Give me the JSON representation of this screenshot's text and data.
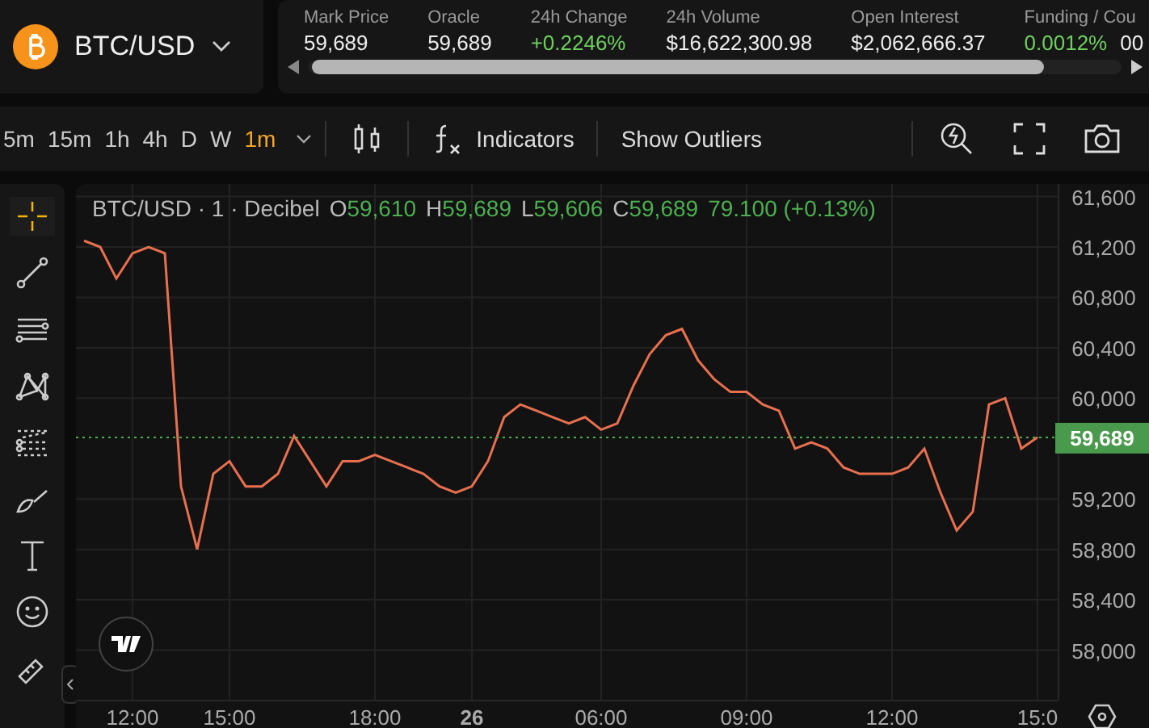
{
  "market": {
    "symbol": "BTC/USD"
  },
  "stats": [
    {
      "label": "Mark Price",
      "value": "59,689",
      "positive": false
    },
    {
      "label": "Oracle",
      "value": "59,689",
      "positive": false
    },
    {
      "label": "24h Change",
      "value": "+0.2246%",
      "positive": true
    },
    {
      "label": "24h Volume",
      "value": "$16,622,300.98",
      "positive": false
    },
    {
      "label": "Open Interest",
      "value": "$2,062,666.37",
      "positive": false
    },
    {
      "label": "Funding / Cou",
      "value": "0.0012%",
      "positive": true,
      "suffix": "00"
    }
  ],
  "toolbar": {
    "timeframes": [
      {
        "label": "5m",
        "selected": false
      },
      {
        "label": "15m",
        "selected": false
      },
      {
        "label": "1h",
        "selected": false
      },
      {
        "label": "4h",
        "selected": false
      },
      {
        "label": "D",
        "selected": false
      },
      {
        "label": "W",
        "selected": false
      },
      {
        "label": "1m",
        "selected": true
      }
    ],
    "indicators": "Indicators",
    "outliers": "Show Outliers"
  },
  "tools": [
    {
      "kind": "crosshair",
      "selected": true
    },
    {
      "kind": "trendline",
      "selected": false
    },
    {
      "kind": "lines",
      "selected": false
    },
    {
      "kind": "pattern",
      "selected": false
    },
    {
      "kind": "fib",
      "selected": false
    },
    {
      "kind": "brush",
      "selected": false
    },
    {
      "kind": "text",
      "selected": false
    },
    {
      "kind": "emoji",
      "selected": false
    },
    {
      "kind": "ruler",
      "selected": false
    }
  ],
  "legend": {
    "title": "BTC/USD · 1 · Decibel",
    "ohlc": [
      {
        "label": "O",
        "value": "59,610"
      },
      {
        "label": "H",
        "value": "59,689"
      },
      {
        "label": "L",
        "value": "59,606"
      },
      {
        "label": "C",
        "value": "59,689"
      }
    ],
    "change": "79.100 (+0.13%)"
  },
  "chart": {
    "chart_data": {
      "type": "line",
      "grid": true,
      "ylim": [
        57600,
        61700
      ],
      "categories": [
        null,
        null,
        null,
        "12:00",
        null,
        null,
        null,
        null,
        null,
        "15:00",
        null,
        null,
        null,
        null,
        null,
        null,
        null,
        null,
        "18:00",
        null,
        null,
        null,
        null,
        null,
        "26",
        null,
        null,
        null,
        null,
        null,
        null,
        null,
        "06:00",
        null,
        null,
        null,
        null,
        null,
        null,
        null,
        null,
        "09:00",
        null,
        null,
        null,
        null,
        null,
        null,
        null,
        null,
        "12:00",
        null,
        null,
        null,
        null,
        null,
        null,
        null,
        null,
        "15:0"
      ],
      "series": [
        {
          "color": "#e8704f",
          "values": [
            61250,
            61200,
            60950,
            61150,
            61200,
            61150,
            59300,
            58800,
            59400,
            59500,
            59300,
            59300,
            59400,
            59700,
            59500,
            59300,
            59500,
            59500,
            59550,
            59500,
            59450,
            59400,
            59300,
            59250,
            59300,
            59500,
            59850,
            59950,
            59900,
            59850,
            59800,
            59850,
            59750,
            59800,
            60100,
            60350,
            60500,
            60550,
            60300,
            60150,
            60050,
            60050,
            59950,
            59900,
            59600,
            59650,
            59600,
            59450,
            59400,
            59400,
            59400,
            59450,
            59600,
            59250,
            58950,
            59100,
            59950,
            60000,
            59600,
            59690
          ]
        }
      ],
      "yticks": [
        {
          "value": 61600,
          "label": "61,600"
        },
        {
          "value": 61200,
          "label": "61,200"
        },
        {
          "value": 60800,
          "label": "60,800"
        },
        {
          "value": 60400,
          "label": "60,400"
        },
        {
          "value": 60000,
          "label": "60,000"
        },
        {
          "value": 59200,
          "label": "59,200"
        },
        {
          "value": 58800,
          "label": "58,800"
        },
        {
          "value": 58400,
          "label": "58,400"
        },
        {
          "value": 58000,
          "label": "58,000"
        }
      ],
      "ref_lines": [
        {
          "axis": "y",
          "value": 59689,
          "label": "59,689"
        }
      ]
    }
  }
}
